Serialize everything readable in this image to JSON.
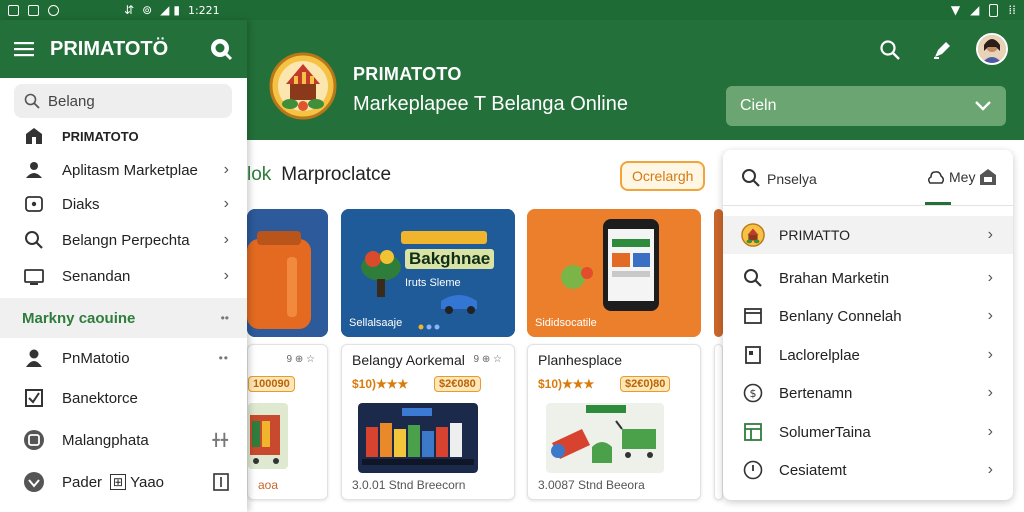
{
  "status_bar": {
    "time": "1:221"
  },
  "header": {
    "brand_name": "PRIMATOTO",
    "brand_tagline": "Markeplapee T Belanga Online",
    "select_value": "Cieln"
  },
  "section": {
    "lead": "lok",
    "title": "Marproclatce",
    "chip_label": "Ocrelargh"
  },
  "banners": [
    {
      "caption": ""
    },
    {
      "caption": "Sellalsaaje",
      "headline": "Bakghnae",
      "subline": "Iruts Sleme"
    },
    {
      "caption": "Sididsocatile"
    }
  ],
  "cards": [
    {
      "meta": "9 ⊕ ☆",
      "price_badge": "100090",
      "foot": "aoa"
    },
    {
      "title": "Belangy Aorkemal",
      "meta": "9 ⊕ ☆",
      "price": "$10)★★★",
      "price_badge": "$2€080",
      "foot": "3.0.01 Stnd Breecorn"
    },
    {
      "title": "Planhesplace",
      "meta": "",
      "price": "$10)★★★",
      "price_badge": "$2€0)80",
      "foot": "3.0087 Stnd Beeora"
    }
  ],
  "drawer": {
    "title": "PRIMATOTÖ",
    "search_placeholder": "Belang",
    "items": [
      {
        "label": "PRIMATOTO",
        "icon": "store-icon"
      },
      {
        "label": "Aplitasm Marketplae",
        "icon": "people-icon"
      },
      {
        "label": "Diaks",
        "icon": "wallet-icon"
      },
      {
        "label": "Belangn Perpechta",
        "icon": "search-icon"
      },
      {
        "label": "Senandan",
        "icon": "monitor-icon"
      }
    ],
    "section_label": "Markny caouine",
    "section_items": [
      {
        "label": "PnMatotio",
        "icon": "person-icon"
      },
      {
        "label": "Banektorce",
        "icon": "checkbox-icon"
      },
      {
        "label": "Malangphata",
        "icon": "tag-icon"
      },
      {
        "label": "Pader",
        "extra": "Yaao",
        "icon": "shield-icon"
      }
    ]
  },
  "right_panel": {
    "search_label": "Pnselya",
    "tab_label": "Mey",
    "items": [
      {
        "label": "PRIMATTO",
        "icon": "logo-icon"
      },
      {
        "label": "Brahan Marketin",
        "icon": "search-icon"
      },
      {
        "label": "Benlany Connelah",
        "icon": "window-icon"
      },
      {
        "label": "Laclorelplae",
        "icon": "document-icon"
      },
      {
        "label": "Bertenamn",
        "icon": "dollar-icon"
      },
      {
        "label": "SolumerTaina",
        "icon": "table-icon"
      },
      {
        "label": "Cesiatemt",
        "icon": "clock-icon"
      }
    ]
  }
}
